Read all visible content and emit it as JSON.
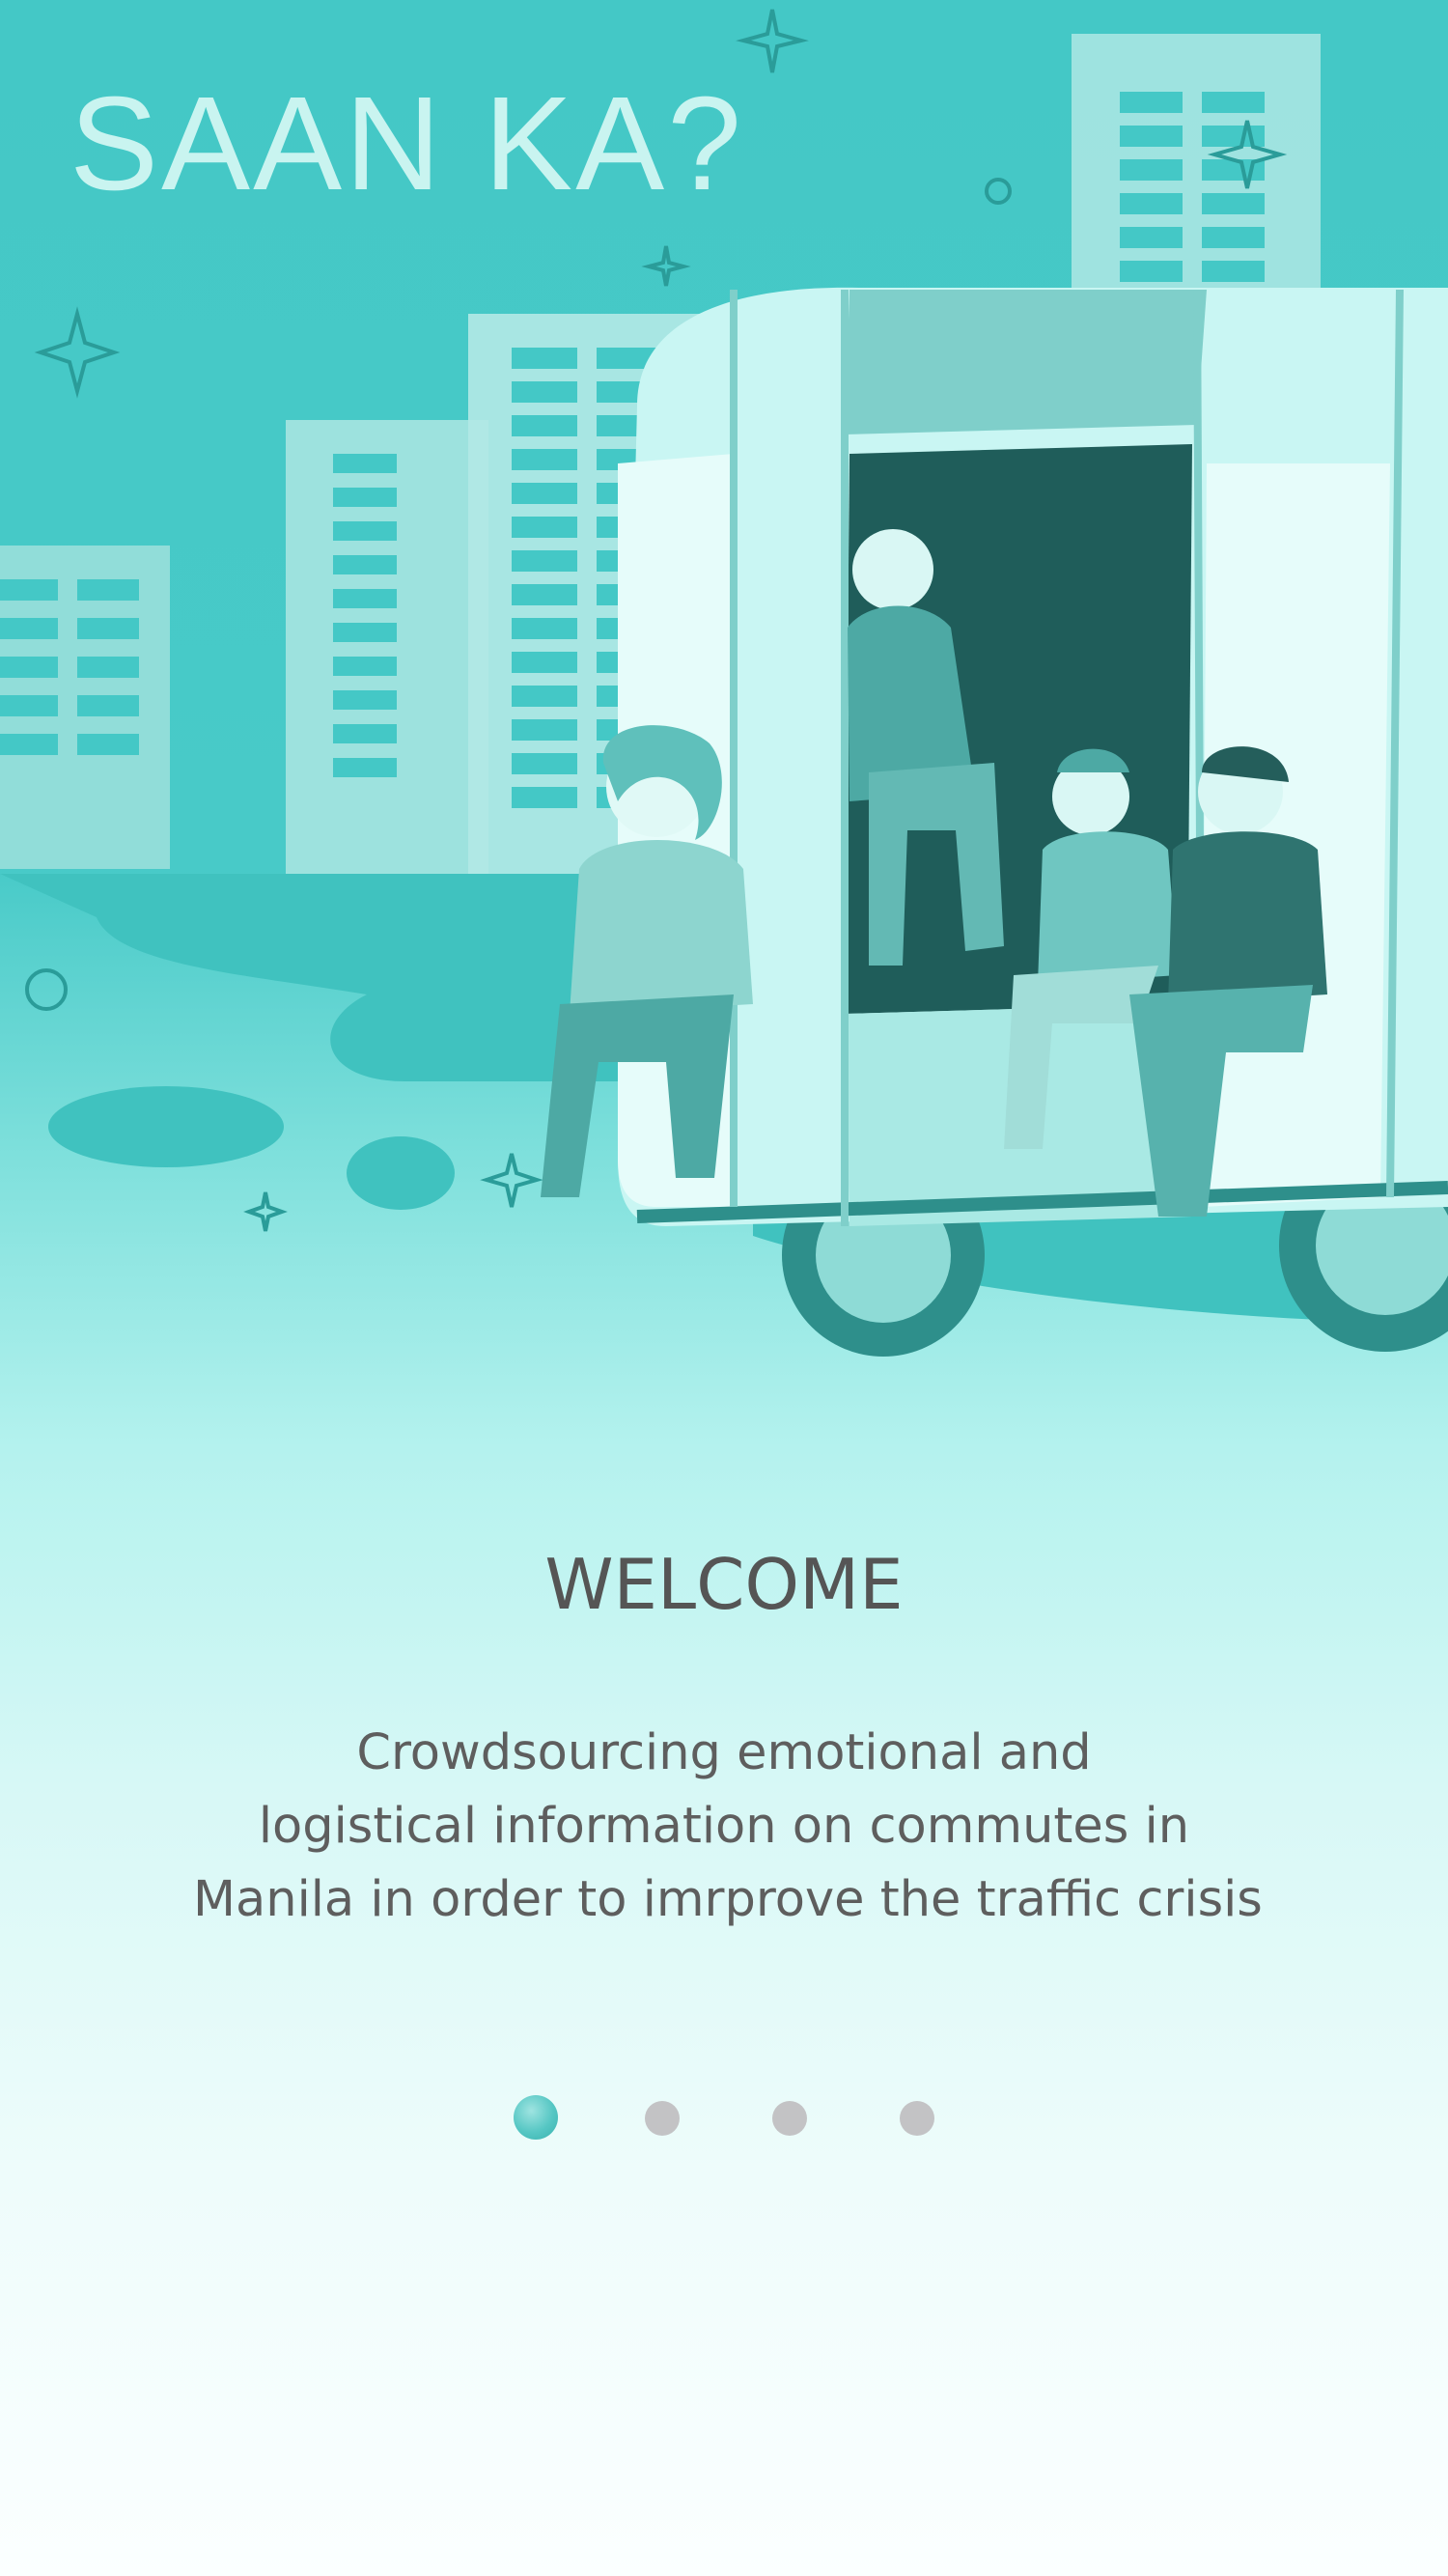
{
  "app": {
    "title": "SAAN KA?"
  },
  "onboarding": {
    "heading": "WELCOME",
    "description_lines": [
      "Crowdsourcing emotional and",
      "logistical information on commutes in",
      "Manila in order to imrprove the traffic crisis"
    ],
    "pagination": {
      "total_pages": 4,
      "current_page": 1
    }
  },
  "illustration": {
    "subject": "jeepney-passengers-illustration"
  },
  "colors": {
    "accent": "#44c8c6",
    "title_text": "#c9f4f0",
    "body_text": "#5e5e5e",
    "dot_active": "#56c7c4",
    "dot_inactive": "#c3c3c5"
  }
}
